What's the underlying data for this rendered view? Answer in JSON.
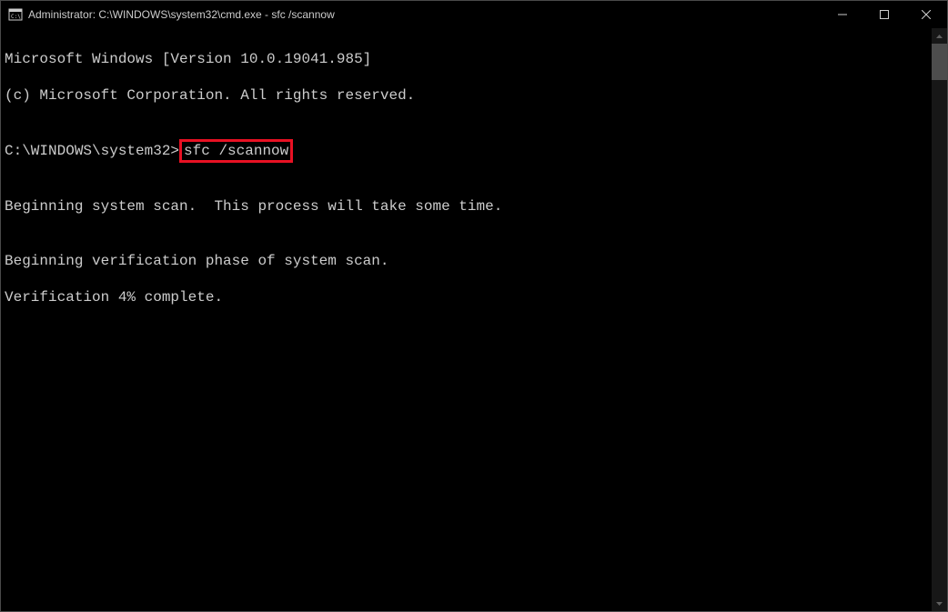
{
  "titlebar": {
    "title": "Administrator: C:\\WINDOWS\\system32\\cmd.exe - sfc  /scannow"
  },
  "terminal": {
    "line1": "Microsoft Windows [Version 10.0.19041.985]",
    "line2": "(c) Microsoft Corporation. All rights reserved.",
    "blank1": "",
    "prompt_path": "C:\\WINDOWS\\system32>",
    "prompt_command": "sfc /scannow",
    "blank2": "",
    "line5": "Beginning system scan.  This process will take some time.",
    "blank3": "",
    "line7": "Beginning verification phase of system scan.",
    "line8": "Verification 4% complete."
  },
  "colors": {
    "highlight_border": "#e81123",
    "background": "#000000",
    "foreground": "#cccccc"
  }
}
